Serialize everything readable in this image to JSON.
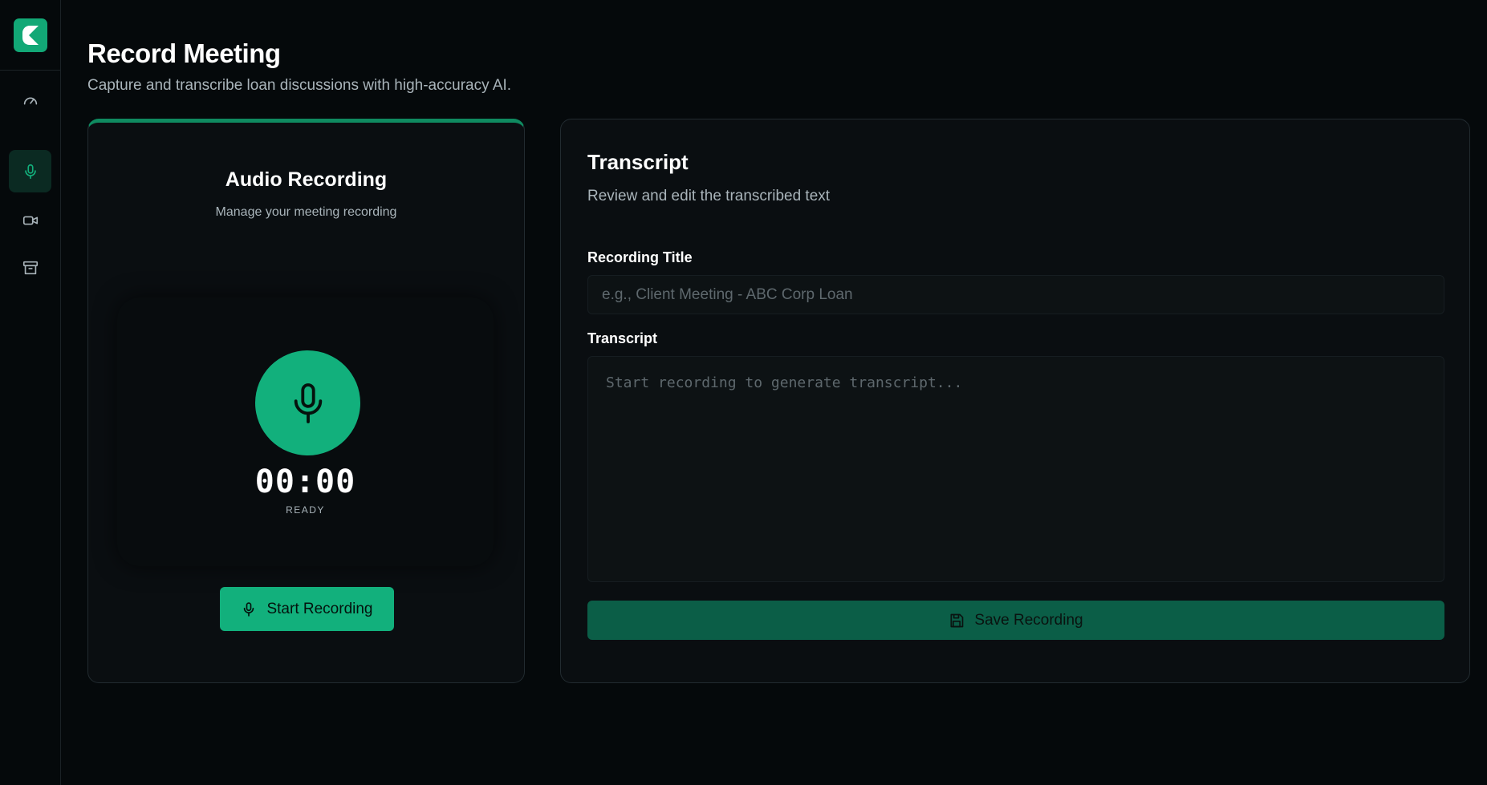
{
  "colors": {
    "accent": "#12b07c",
    "accent_dark": "#0b5e47",
    "background": "#05090b",
    "card": "#0a0e11"
  },
  "sidebar": {
    "logo_icon": "app-logo-icon",
    "items": [
      {
        "icon": "gauge-icon",
        "active": false
      },
      {
        "icon": "microphone-icon",
        "active": true
      },
      {
        "icon": "video-camera-icon",
        "active": false
      },
      {
        "icon": "archive-icon",
        "active": false
      }
    ]
  },
  "header": {
    "title": "Record Meeting",
    "subtitle": "Capture and transcribe loan discussions with high-accuracy AI."
  },
  "audio": {
    "title": "Audio Recording",
    "subtitle": "Manage your meeting recording",
    "timer": "00:00",
    "status": "READY",
    "start_label": "Start Recording"
  },
  "transcript": {
    "title": "Transcript",
    "subtitle": "Review and edit the transcribed text",
    "recording_title_label": "Recording Title",
    "recording_title_placeholder": "e.g., Client Meeting - ABC Corp Loan",
    "recording_title_value": "",
    "transcript_label": "Transcript",
    "transcript_placeholder": "Start recording to generate transcript...",
    "transcript_value": "",
    "save_label": "Save Recording"
  }
}
